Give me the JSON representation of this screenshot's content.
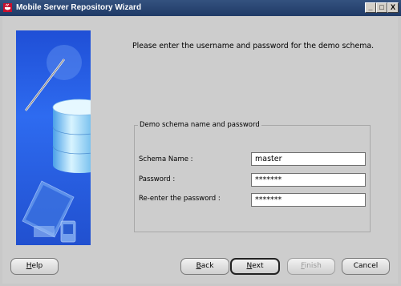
{
  "window": {
    "title": "Mobile Server Repository Wizard",
    "controls": [
      "_",
      "□",
      "X"
    ]
  },
  "prompt": "Please enter the username and password for the demo schema.",
  "group": {
    "legend": "Demo schema name and password",
    "fields": [
      {
        "label": "Schema Name :",
        "value": "master"
      },
      {
        "label": "Password :",
        "value": "*******"
      },
      {
        "label": "Re-enter the password :",
        "value": "*******"
      }
    ]
  },
  "buttons": {
    "help": {
      "pre": "",
      "mnemonic": "H",
      "post": "elp"
    },
    "back": {
      "pre": "",
      "mnemonic": "B",
      "post": "ack"
    },
    "next": {
      "pre": "",
      "mnemonic": "N",
      "post": "ext"
    },
    "finish": {
      "pre": "",
      "mnemonic": "F",
      "post": "inish"
    },
    "cancel": "Cancel"
  },
  "colors": {
    "title_bar": "#1f3a66",
    "side_panel": "#2e6bf0"
  }
}
